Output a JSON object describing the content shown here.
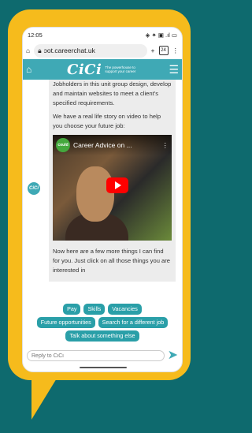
{
  "status": {
    "time": "12:05",
    "icons": "◈ ✦ ▣ .ıl ▭"
  },
  "browser": {
    "url": "ɔot.careerchat.uk",
    "tabs": "24"
  },
  "header": {
    "logo": "CiCi",
    "tagline": "The powerhouse to support your career"
  },
  "chat": {
    "para1": "Jobholders in this unit group design, develop and maintain websites to meet a client's specified requirements.",
    "para2": "We have a real life story on video to help you choose your future job:",
    "video": {
      "channel": "could",
      "title": "Career Advice on ..."
    },
    "para3": "Now here are a few more things I can find for you. Just click on all those things you are interested in",
    "avatar": "CiCi"
  },
  "chips": {
    "pay": "Pay",
    "skills": "Skills",
    "vacancies": "Vacancies",
    "future": "Future opportunities",
    "search": "Search for a different job",
    "talk": "Talk about something else"
  },
  "input": {
    "placeholder": "Reply to CiCi"
  },
  "colors": {
    "bubble": "#f6bb1c",
    "background": "#0e6a6e",
    "accent": "#3fa9b5",
    "chip": "#2a9fa8"
  }
}
